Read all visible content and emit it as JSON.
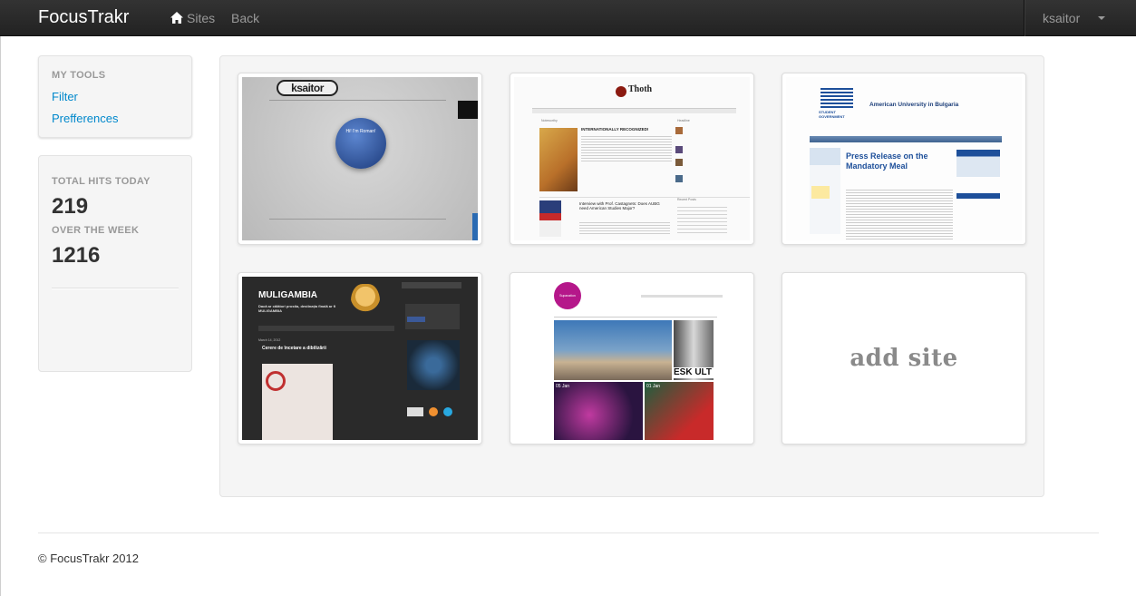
{
  "navbar": {
    "brand": "FocusTrakr",
    "sites_label": "Sites",
    "back_label": "Back",
    "user": "ksaitor"
  },
  "sidebar": {
    "tools_header": "MY TOOLS",
    "tools": [
      {
        "label": "Filter"
      },
      {
        "label": "Prefferences"
      }
    ],
    "stats": {
      "today_label": "TOTAL HITS TODAY",
      "today_value": "219",
      "week_label": "OVER THE WEEK",
      "week_value": "1216"
    }
  },
  "sites": [
    {
      "id": "ksaitor",
      "logo_text": "ksaitor",
      "bubble_text": "Hi! I'm Roman!"
    },
    {
      "id": "thoth",
      "title": "Thoth",
      "headline": "INTERNATIONALLY RECOGNIZED!",
      "interview": "Interview with Prof. Castagnets: Does AUBG need American Studies Major?",
      "section1": "Headline",
      "section2": "Noteworthy",
      "section3": "Recent Posts"
    },
    {
      "id": "aubg-sg",
      "title": "American University in Bulgaria",
      "logo": "STUDENT GOVERNMENT",
      "headline": "Press Release on the Mandatory Meal"
    },
    {
      "id": "muligambia",
      "title": "MULIGAMBIA",
      "tagline": "Dacă ar călători prostia, destinația finală ar fi MULIGAMBIA",
      "post": "Cerere de încetare a dibilizării"
    },
    {
      "id": "supanation",
      "logo": "Supanation",
      "overlay": "ESK ULT",
      "date1": "05 Jan",
      "date2": "01 Jan"
    }
  ],
  "add_site_label": "add site",
  "footer": "© FocusTrakr 2012",
  "colors": {
    "navbar": "#222222",
    "link": "#0088cc",
    "muted": "#999999"
  }
}
